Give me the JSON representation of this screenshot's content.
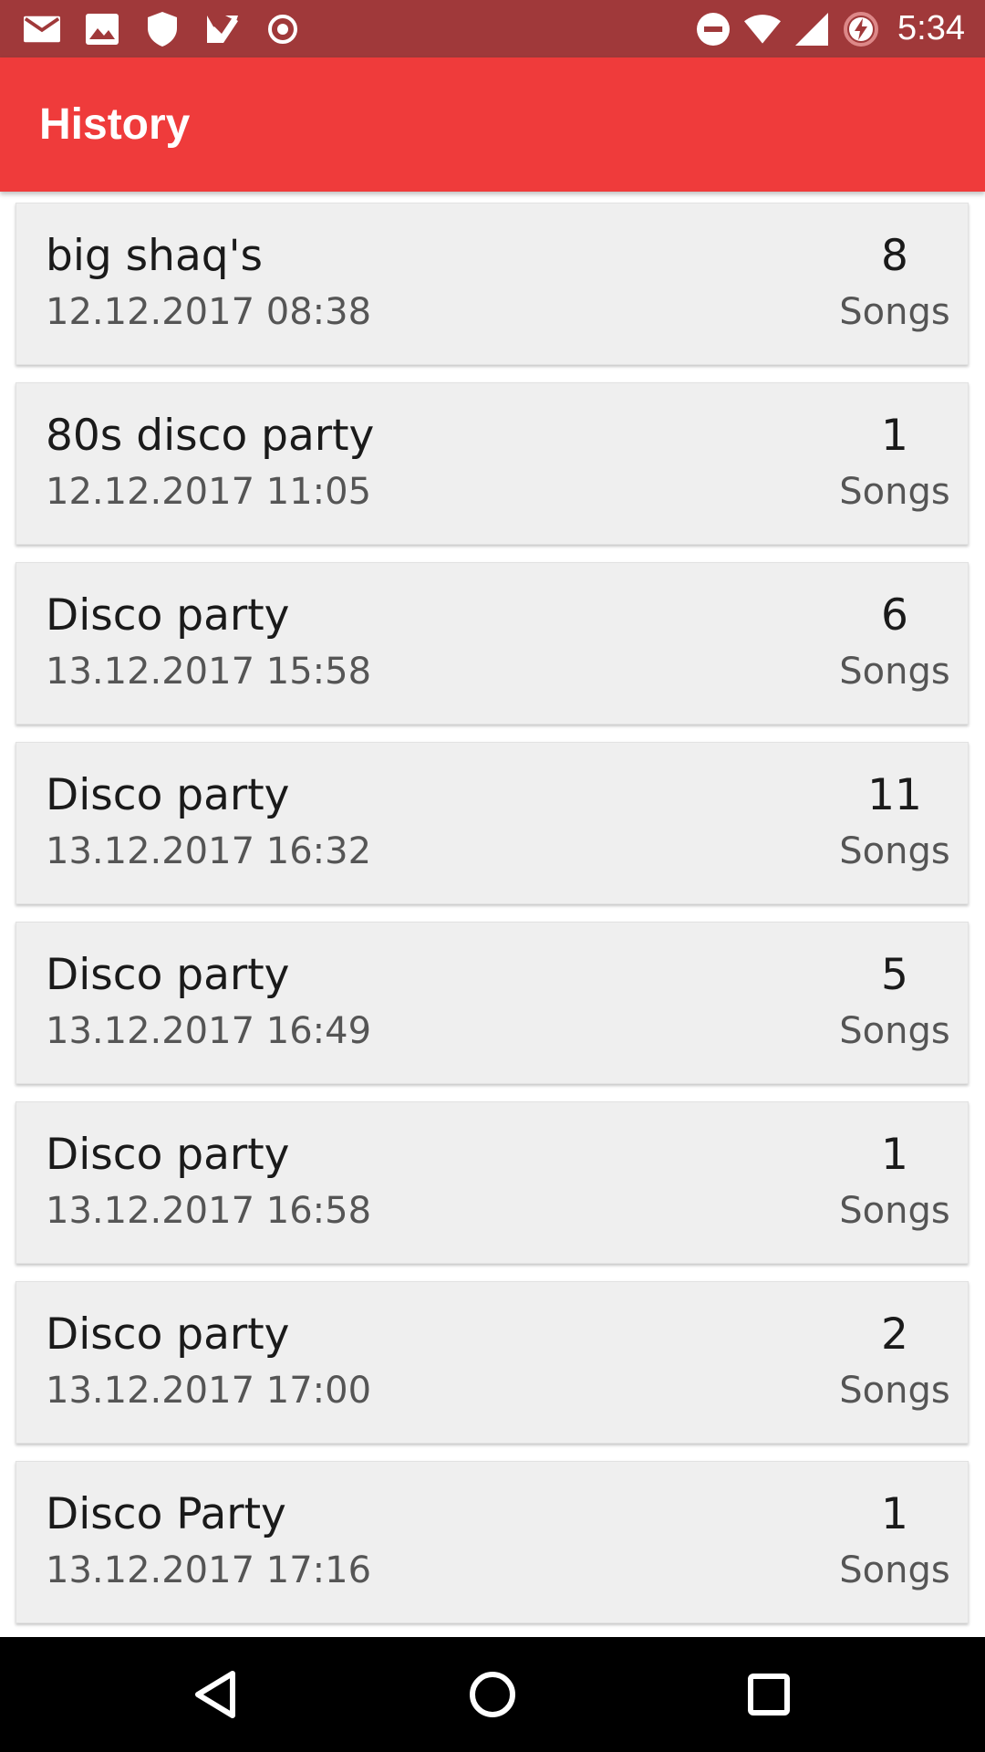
{
  "status_bar": {
    "time": "5:34",
    "left_icons": [
      "mail-icon",
      "image-icon",
      "shield-icon",
      "checklist-icon",
      "target-icon"
    ],
    "right_icons": [
      "do-not-disturb-icon",
      "wifi-icon",
      "signal-icon",
      "battery-charging-icon"
    ]
  },
  "app_bar": {
    "title": "History"
  },
  "history": [
    {
      "title": "big shaq's",
      "date": "12.12.2017 08:38",
      "count": "8",
      "unit": "Songs"
    },
    {
      "title": "80s disco party",
      "date": "12.12.2017 11:05",
      "count": "1",
      "unit": "Songs"
    },
    {
      "title": "Disco party",
      "date": "13.12.2017 15:58",
      "count": "6",
      "unit": "Songs"
    },
    {
      "title": "Disco party",
      "date": "13.12.2017 16:32",
      "count": "11",
      "unit": "Songs"
    },
    {
      "title": "Disco party",
      "date": "13.12.2017 16:49",
      "count": "5",
      "unit": "Songs"
    },
    {
      "title": "Disco party",
      "date": "13.12.2017 16:58",
      "count": "1",
      "unit": "Songs"
    },
    {
      "title": "Disco party",
      "date": "13.12.2017 17:00",
      "count": "2",
      "unit": "Songs"
    },
    {
      "title": "Disco Party",
      "date": "13.12.2017 17:16",
      "count": "1",
      "unit": "Songs"
    }
  ],
  "nav_bar": {
    "icons": [
      "back-icon",
      "home-icon",
      "recents-icon"
    ]
  },
  "colors": {
    "status_bar": "#a0393a",
    "app_bar": "#ef3b3b",
    "card": "#efefef",
    "nav_bar": "#000000"
  }
}
